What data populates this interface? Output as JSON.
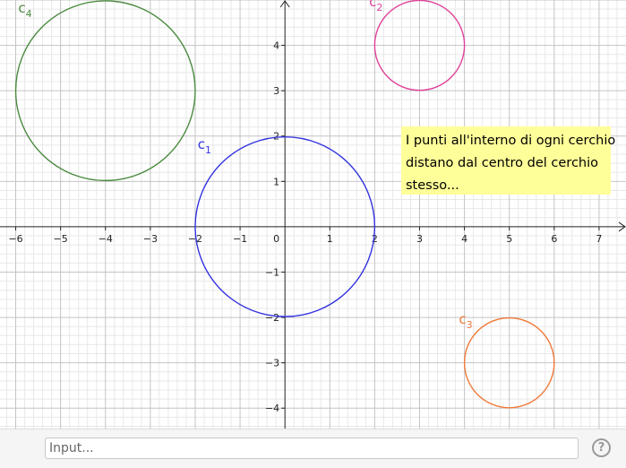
{
  "graphics": {
    "x_range": [
      -6.35,
      7.6
    ],
    "y_range": [
      -4.45,
      5.0
    ],
    "x_ticks": [
      -6,
      -5,
      -4,
      -3,
      -2,
      -1,
      1,
      2,
      3,
      4,
      5,
      6,
      7
    ],
    "y_ticks": [
      -4,
      -3,
      -2,
      -1,
      1,
      2,
      3,
      4
    ],
    "origin_label": "0",
    "grid_minor": true,
    "circles": [
      {
        "name": "c1",
        "base": "c",
        "sub": "1",
        "cx": 0,
        "cy": 0,
        "r": 2,
        "color": "#3333e0"
      },
      {
        "name": "c2",
        "base": "c",
        "sub": "2",
        "cx": 3,
        "cy": 4,
        "r": 1,
        "color": "#e0409a"
      },
      {
        "name": "c3",
        "base": "c",
        "sub": "3",
        "cx": 5,
        "cy": -3,
        "r": 1,
        "color": "#f07a3a"
      },
      {
        "name": "c4",
        "base": "c",
        "sub": "4",
        "cx": -4,
        "cy": 3,
        "r": 2,
        "color": "#4a8a3f"
      }
    ]
  },
  "note": {
    "lines": [
      "I punti all'interno di ogni cerchio",
      "distano dal centro del cerchio",
      "stesso..."
    ]
  },
  "input_bar": {
    "placeholder": "Input...",
    "help_label": "?"
  }
}
